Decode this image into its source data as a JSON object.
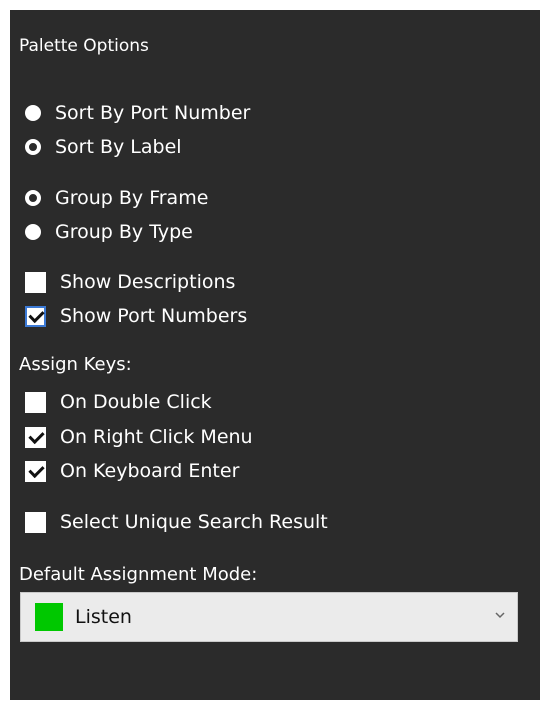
{
  "panel": {
    "title": "Palette Options",
    "sort": [
      {
        "label": "Sort By Port Number",
        "selected": false
      },
      {
        "label": "Sort By Label",
        "selected": true
      }
    ],
    "group": [
      {
        "label": "Group By Frame",
        "selected": true
      },
      {
        "label": "Group By Type",
        "selected": false
      }
    ],
    "display": [
      {
        "label": "Show Descriptions",
        "checked": false
      },
      {
        "label": "Show Port Numbers",
        "checked": true
      }
    ],
    "assign_keys_label": "Assign Keys:",
    "assign_keys": [
      {
        "label": "On Double Click",
        "checked": false
      },
      {
        "label": "On Right Click Menu",
        "checked": true
      },
      {
        "label": "On Keyboard Enter",
        "checked": true
      }
    ],
    "select_unique": {
      "label": "Select Unique Search Result",
      "checked": false
    },
    "default_mode_label": "Default Assignment Mode:",
    "default_mode": {
      "value": "Listen",
      "swatch_color": "#00c800",
      "icon": "chevron-down-icon"
    }
  }
}
